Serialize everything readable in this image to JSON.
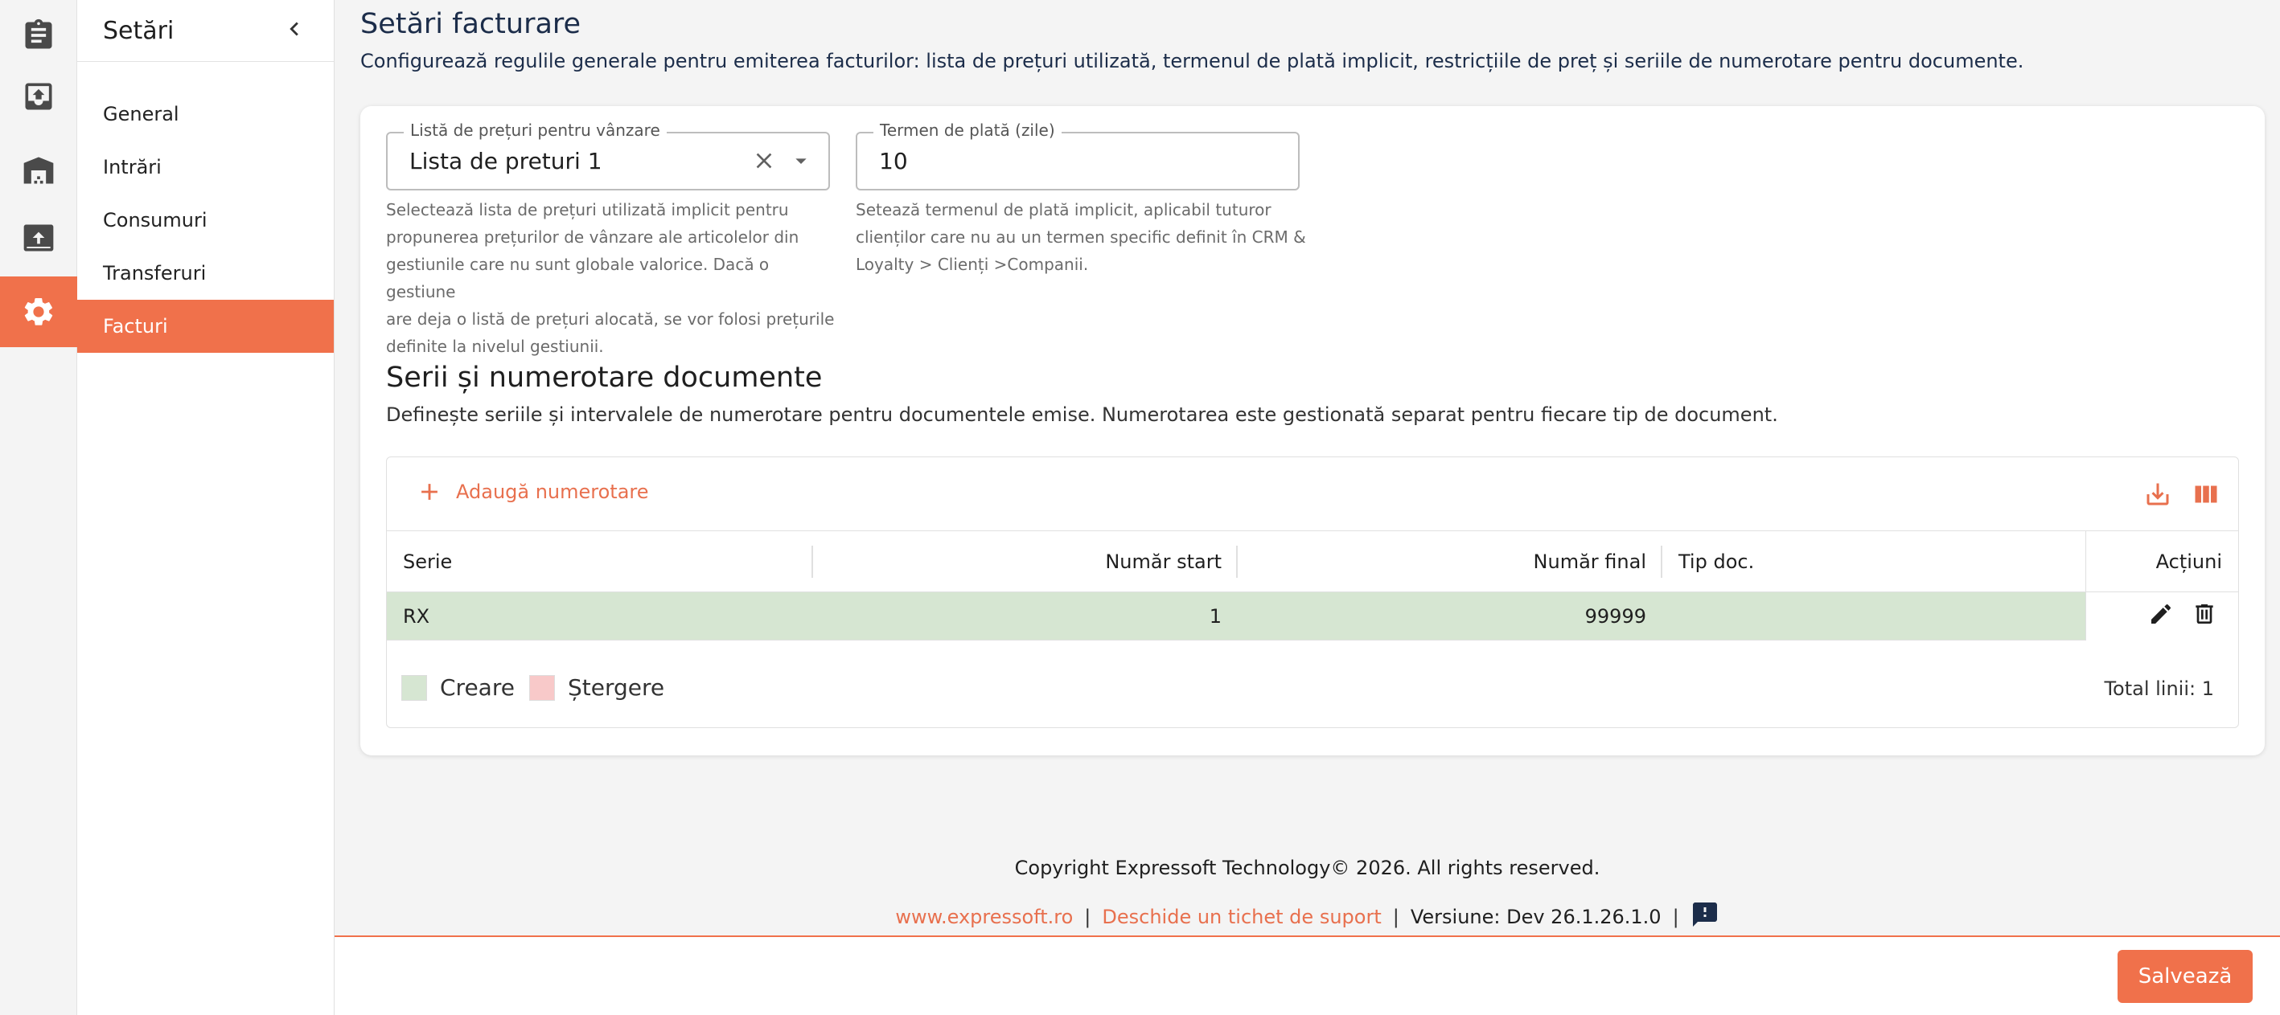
{
  "rail": {
    "icons": [
      "clipboard-icon",
      "inbox-upload-icon",
      "warehouse-icon",
      "archive-icon",
      "gear-icon"
    ]
  },
  "menu": {
    "title": "Setări",
    "items": [
      {
        "label": "General"
      },
      {
        "label": "Intrări"
      },
      {
        "label": "Consumuri"
      },
      {
        "label": "Transferuri"
      },
      {
        "label": "Facturi"
      }
    ],
    "active": "Facturi"
  },
  "page": {
    "title": "Setări facturare",
    "description": "Configurează regulile generale pentru emiterea facturilor: lista de prețuri utilizată, termenul de plată implicit, restricțiile de preț și seriile de numerotare pentru documente."
  },
  "fields": {
    "price_list": {
      "label": "Listă de prețuri pentru vânzare",
      "value": "Lista de preturi 1",
      "helper": [
        "Selectează lista de prețuri utilizată implicit pentru",
        "propunerea prețurilor de vânzare ale articolelor din",
        "gestiunile care nu sunt globale valorice. Dacă o gestiune",
        "are deja o listă de prețuri alocată, se vor folosi prețurile",
        "definite la nivelul gestiunii."
      ]
    },
    "payment_term": {
      "label": "Termen de plată (zile)",
      "value": "10",
      "helper": [
        "Setează termenul de plată implicit, aplicabil tuturor",
        "clienților care nu au un termen specific definit în CRM &",
        "Loyalty > Clienți >Companii."
      ]
    }
  },
  "series_section": {
    "title": "Serii și numerotare documente",
    "description": "Definește seriile și intervalele de numerotare pentru documentele emise. Numerotarea este gestionată separat pentru fiecare tip de document."
  },
  "grid": {
    "add_label": "Adaugă numerotare",
    "columns": {
      "serie": "Serie",
      "start": "Număr start",
      "end": "Număr final",
      "type": "Tip doc.",
      "actions": "Acțiuni"
    },
    "rows": [
      {
        "serie": "RX",
        "start": "1",
        "end": "99999",
        "type": ""
      }
    ],
    "legend": {
      "create": "Creare",
      "delete": "Ștergere"
    },
    "total": "Total linii: 1"
  },
  "colors": {
    "accent": "#f0714b",
    "create_row": "#d6e6d2",
    "delete_swatch": "#f8c9c9"
  },
  "footer": {
    "copyright": "Copyright Expressoft Technology© 2026. All rights reserved.",
    "site": "www.expressoft.ro",
    "ticket": "Deschide un tichet de suport",
    "version": "Versiune: Dev 26.1.26.1.0"
  },
  "actions": {
    "save": "Salvează"
  }
}
